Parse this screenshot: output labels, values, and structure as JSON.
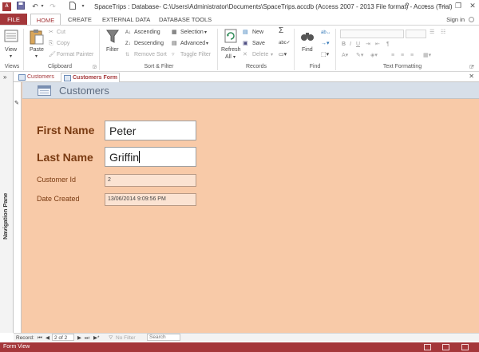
{
  "window": {
    "title": "SpaceTrips : Database- C:\\Users\\Administrator\\Documents\\SpaceTrips.accdb (Access 2007 - 2013 File format) - Access (Trial)",
    "help": "?",
    "minimize": "—",
    "restore": "❐",
    "close": "✕",
    "sign_in": "Sign in"
  },
  "ribbon_tabs": [
    "FILE",
    "HOME",
    "CREATE",
    "EXTERNAL DATA",
    "DATABASE TOOLS"
  ],
  "ribbon": {
    "views": {
      "view": "View",
      "group": "Views"
    },
    "clipboard": {
      "paste": "Paste",
      "cut": "Cut",
      "copy": "Copy",
      "format_painter": "Format Painter",
      "group": "Clipboard"
    },
    "sort_filter": {
      "filter": "Filter",
      "ascending": "Ascending",
      "descending": "Descending",
      "remove_sort": "Remove Sort",
      "selection": "Selection",
      "advanced": "Advanced",
      "toggle_filter": "Toggle Filter",
      "group": "Sort & Filter"
    },
    "records": {
      "refresh": "Refresh",
      "refresh_all": "All",
      "new": "New",
      "save": "Save",
      "delete": "Delete",
      "group": "Records"
    },
    "find": {
      "find": "Find",
      "group": "Find"
    },
    "text_formatting": {
      "group": "Text Formatting"
    }
  },
  "nav_pane": {
    "label": "Navigation Pane",
    "toggle": "»"
  },
  "doc_tabs": [
    {
      "label": "Customers"
    },
    {
      "label": "Customers Form"
    }
  ],
  "doc_close": "✕",
  "form": {
    "header_title": "Customers",
    "first_name": {
      "label": "First Name",
      "value": "Peter"
    },
    "last_name": {
      "label": "Last Name",
      "value": "Griffin"
    },
    "customer_id": {
      "label": "Customer Id",
      "value": "2"
    },
    "date_created": {
      "label": "Date Created",
      "value": "13/06/2014 9:09:56 PM"
    }
  },
  "record_nav": {
    "record_label": "Record:",
    "first": "⏮",
    "prev": "◀",
    "position": "2 of 2",
    "next": "▶",
    "last": "⏭",
    "new": "▶*",
    "filter_status": "No Filter",
    "search_placeholder": "Search"
  },
  "status_bar": {
    "text": "Form View"
  },
  "colors": {
    "accent": "#a4373a",
    "form_background": "#f8caa8",
    "label_text": "#7a3b12",
    "form_header": "#d7dfe9"
  }
}
